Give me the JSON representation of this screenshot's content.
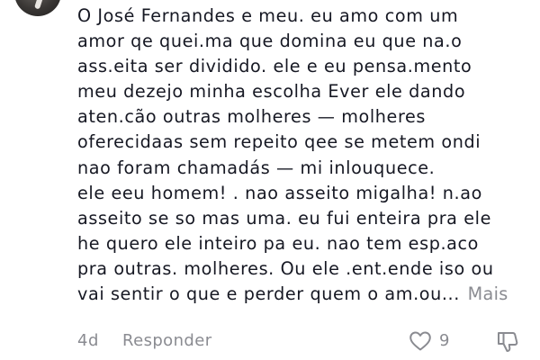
{
  "comment": {
    "lines": [
      "O José Fernandes e meu. eu amo com um",
      "amor qe quei.ma que domina eu que na.o",
      "ass.eita ser dividido. ele e eu pensa.mento",
      "meu dezejo minha escolha Ever ele dando",
      "aten.cão outras molheres — molheres",
      "oferecidaas sem repeito qee se metem ondi",
      "nao foram chamadás — mi inlouquece.",
      "ele eeu homem! . nao asseito migalha! n.ao",
      "asseito se so mas uma. eu fui enteira pra ele",
      "he quero ele inteiro pa eu. nao tem esp.aco",
      "pra outras. molheres. Ou ele .ent.ende iso ou",
      "vai sentir o que e perder quem o am.ou..."
    ],
    "more_label": "Mais"
  },
  "footer": {
    "time": "4d",
    "reply_label": "Responder",
    "like_count": "9"
  },
  "icons": {
    "like": "heart-outline-icon",
    "dislike": "thumbs-down-outline-icon"
  },
  "colors": {
    "text": "#161823",
    "secondary": "#8a8b91",
    "background": "#ffffff"
  }
}
